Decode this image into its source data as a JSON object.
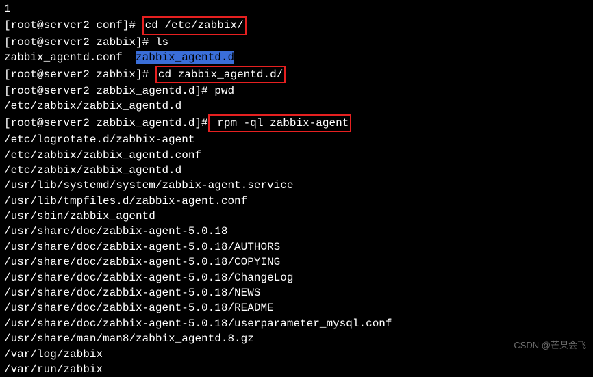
{
  "term": {
    "l0": "1",
    "p1_prefix": "[root@server2 conf]# ",
    "cmd1": "cd /etc/zabbix/",
    "p2_prefix": "[root@server2 zabbix]# ",
    "cmd2": "ls",
    "ls_item1": "zabbix_agentd.conf  ",
    "ls_item2": "zabbix_agentd.d",
    "p3_prefix": "[root@server2 zabbix]# ",
    "cmd3": "cd zabbix_agentd.d/",
    "p4_prefix": "[root@server2 zabbix_agentd.d]# ",
    "cmd4": "pwd",
    "pwd_out": "/etc/zabbix/zabbix_agentd.d",
    "p5_prefix": "[root@server2 zabbix_agentd.d]#",
    "cmd5": " rpm -ql zabbix-agent",
    "out1": "/etc/logrotate.d/zabbix-agent",
    "out2": "/etc/zabbix/zabbix_agentd.conf",
    "out3": "/etc/zabbix/zabbix_agentd.d",
    "out4": "/usr/lib/systemd/system/zabbix-agent.service",
    "out5": "/usr/lib/tmpfiles.d/zabbix-agent.conf",
    "out6": "/usr/sbin/zabbix_agentd",
    "out7": "/usr/share/doc/zabbix-agent-5.0.18",
    "out8": "/usr/share/doc/zabbix-agent-5.0.18/AUTHORS",
    "out9": "/usr/share/doc/zabbix-agent-5.0.18/COPYING",
    "out10": "/usr/share/doc/zabbix-agent-5.0.18/ChangeLog",
    "out11": "/usr/share/doc/zabbix-agent-5.0.18/NEWS",
    "out12": "/usr/share/doc/zabbix-agent-5.0.18/README",
    "out13": "/usr/share/doc/zabbix-agent-5.0.18/userparameter_mysql.conf",
    "out14": "/usr/share/man/man8/zabbix_agentd.8.gz",
    "out15": "/var/log/zabbix",
    "out16": "/var/run/zabbix"
  },
  "watermark": "CSDN @芒果会飞"
}
